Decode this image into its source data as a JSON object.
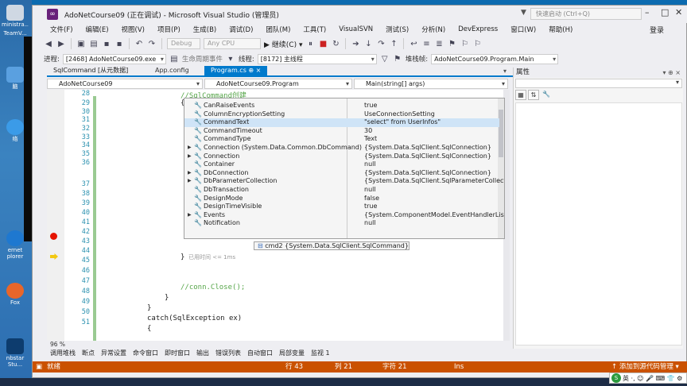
{
  "window": {
    "title": "AdoNetCourse09 (正在调试) - Microsoft Visual Studio (管理员)",
    "quick_launch_placeholder": "快速启动 (Ctrl+Q)",
    "login": "登录"
  },
  "menu": [
    "文件(F)",
    "编辑(E)",
    "视图(V)",
    "项目(P)",
    "生成(B)",
    "调试(D)",
    "团队(M)",
    "工具(T)",
    "VisualSVN",
    "测试(S)",
    "分析(N)",
    "DevExpress",
    "窗口(W)",
    "帮助(H)"
  ],
  "toolbar": {
    "config": "Debug",
    "platform": "Any CPU",
    "continue_label": "▶ 继续(C) ▾"
  },
  "debug_location": {
    "process_label": "进程:",
    "process_value": "[2468] AdoNetCourse09.exe",
    "lifecycle_label": "生命周期事件",
    "thread_label": "线程:",
    "thread_value": "[8172] 主线程",
    "stack_label": "堆栈帧:",
    "stack_value": "AdoNetCourse09.Program.Main"
  },
  "tabs": [
    {
      "label": "SqlCommand [从元数据]",
      "state": "normal"
    },
    {
      "label": "App.config",
      "state": "normal"
    },
    {
      "label": "Program.cs ⊕ ×",
      "state": "active"
    }
  ],
  "navbar": {
    "project": "AdoNetCourse09",
    "class": "AdoNetCourse09.Program",
    "member": "Main(string[] args)"
  },
  "editor": {
    "line_numbers": [
      "28",
      "29",
      "30",
      "31",
      "32",
      "33",
      "34",
      "35",
      "36",
      "37",
      "38",
      "39",
      "40",
      "41",
      "42",
      "43",
      "44",
      "45",
      "46",
      "47",
      "48",
      "49",
      "50",
      "51"
    ],
    "lines": {
      "l28": "//SqlCommand创建",
      "l29": "{",
      "l43": "}",
      "l46": "//conn.Close();",
      "l47": "}",
      "l48": "}",
      "l49": "catch(SqlException ex)",
      "l50": "{"
    },
    "elapsed": "已用时间 <= 1ms",
    "zoom": "96 %"
  },
  "datatip": {
    "root": "cmd2 {System.Data.SqlClient.SqlCommand}",
    "rows": [
      {
        "name": "CanRaiseEvents",
        "value": "true",
        "expand": ""
      },
      {
        "name": "ColumnEncryptionSetting",
        "value": "UseConnectionSetting",
        "expand": ""
      },
      {
        "name": "CommandText",
        "value": "\"select\" from UserInfos\"",
        "expand": ""
      },
      {
        "name": "CommandTimeout",
        "value": "30",
        "expand": ""
      },
      {
        "name": "CommandType",
        "value": "Text",
        "expand": ""
      },
      {
        "name": "Connection (System.Data.Common.DbCommand)",
        "value": "{System.Data.SqlClient.SqlConnection}",
        "expand": "▶"
      },
      {
        "name": "Connection",
        "value": "{System.Data.SqlClient.SqlConnection}",
        "expand": "▶"
      },
      {
        "name": "Container",
        "value": "null",
        "expand": ""
      },
      {
        "name": "DbConnection",
        "value": "{System.Data.SqlClient.SqlConnection}",
        "expand": "▶"
      },
      {
        "name": "DbParameterCollection",
        "value": "{System.Data.SqlClient.SqlParameterCollection}",
        "expand": "▶"
      },
      {
        "name": "DbTransaction",
        "value": "null",
        "expand": ""
      },
      {
        "name": "DesignMode",
        "value": "false",
        "expand": ""
      },
      {
        "name": "DesignTimeVisible",
        "value": "true",
        "expand": ""
      },
      {
        "name": "Events",
        "value": "{System.ComponentModel.EventHandlerList}",
        "expand": "▶"
      },
      {
        "name": "Notification",
        "value": "null",
        "expand": ""
      }
    ],
    "selected_index": 2
  },
  "properties": {
    "title": "属性",
    "controls": "▾ ⊕ ×"
  },
  "bottom_tabs": [
    "调用堆栈",
    "断点",
    "异常设置",
    "命令窗口",
    "即时窗口",
    "输出",
    "错误列表",
    "自动窗口",
    "局部变量",
    "监视 1"
  ],
  "status": {
    "state": "就绪",
    "line": "行 43",
    "col": "列 21",
    "char": "字符 21",
    "ins": "Ins",
    "source_control": "↑ 添加到源代码管理 ▾"
  },
  "desktop_icons": [
    "ministra...",
    "TeamV...",
    "n",
    "脑",
    "",
    "络",
    "",
    "ernet",
    "plorer",
    "",
    "Fox",
    "",
    "nbstar",
    "Stu..."
  ],
  "ime": {
    "icon": "S",
    "label": "英 ·, ☺ 🎤 ⌨ 👕 ⚙"
  },
  "colors": {
    "accent": "#007acc",
    "status_bar": "#ca5100",
    "vs_purple": "#68217a",
    "breakpoint": "#e51400"
  }
}
